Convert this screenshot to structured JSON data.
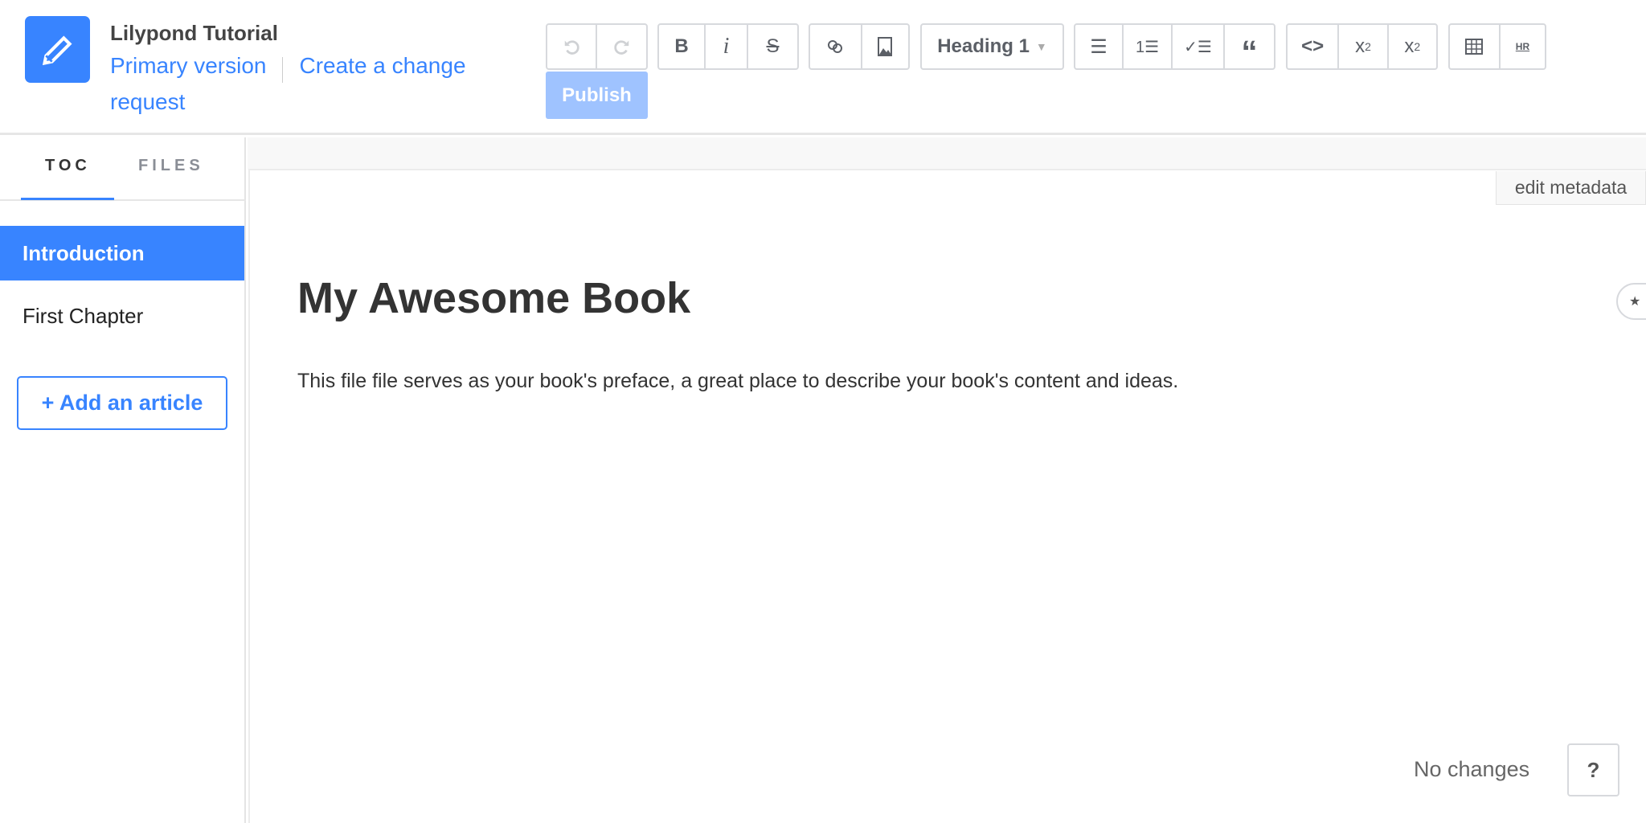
{
  "header": {
    "title": "Lilypond Tutorial",
    "primary_version": "Primary version",
    "change_request": "Create a change request",
    "publish": "Publish",
    "logo_icon": "pencil-icon"
  },
  "toolbar": {
    "heading_select": "Heading 1",
    "bold": "B",
    "italic": "i",
    "strike": "S",
    "subscript": "x",
    "sub_mark": "2",
    "superscript": "x",
    "sup_mark": "2",
    "hr": "HR",
    "quote": "“",
    "code": "<>"
  },
  "sidebar": {
    "tabs": [
      {
        "label": "TOC",
        "active": true
      },
      {
        "label": "FILES",
        "active": false
      }
    ],
    "items": [
      {
        "label": "Introduction",
        "active": true
      },
      {
        "label": "First Chapter",
        "active": false
      }
    ],
    "add_article": "+ Add an article"
  },
  "main": {
    "edit_metadata": "edit metadata",
    "title": "My Awesome Book",
    "paragraph": "This file file serves as your book's preface, a great place to describe your book's content and ideas."
  },
  "footer": {
    "status": "No changes",
    "help": "?"
  },
  "colors": {
    "accent": "#3884ff",
    "publish_disabled": "#9fc3ff"
  }
}
